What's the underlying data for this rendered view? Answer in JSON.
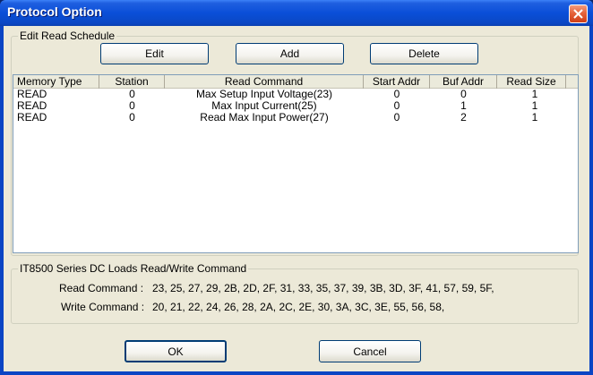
{
  "window": {
    "title": "Protocol Option"
  },
  "edit_group": {
    "legend": "Edit Read Schedule",
    "buttons": {
      "edit": "Edit",
      "add": "Add",
      "delete": "Delete"
    }
  },
  "schedule_table": {
    "columns": [
      "Memory Type",
      "Station",
      "Read Command",
      "Start Addr",
      "Buf Addr",
      "Read Size"
    ],
    "rows": [
      [
        "READ",
        "0",
        "Max Setup Input Voltage(23)",
        "0",
        "0",
        "1"
      ],
      [
        "READ",
        "0",
        "Max Input Current(25)",
        "0",
        "1",
        "1"
      ],
      [
        "READ",
        "0",
        "Read Max Input Power(27)",
        "0",
        "2",
        "1"
      ]
    ]
  },
  "command_group": {
    "legend": "IT8500 Series DC Loads Read/Write Command",
    "read_label": "Read Command :",
    "read_value": "23, 25, 27, 29, 2B, 2D, 2F, 31, 33, 35, 37, 39, 3B, 3D, 3F, 41, 57, 59, 5F,",
    "write_label": "Write Command :",
    "write_value": "20, 21, 22, 24, 26, 28, 2A, 2C, 2E, 30, 3A, 3C, 3E, 55, 56, 58,"
  },
  "footer": {
    "ok": "OK",
    "cancel": "Cancel"
  },
  "colors": {
    "title_bar": "#0a4fd8",
    "dialog_bg": "#ece9d8",
    "close_button": "#e5633c"
  },
  "icons": {
    "close": "close-icon"
  }
}
